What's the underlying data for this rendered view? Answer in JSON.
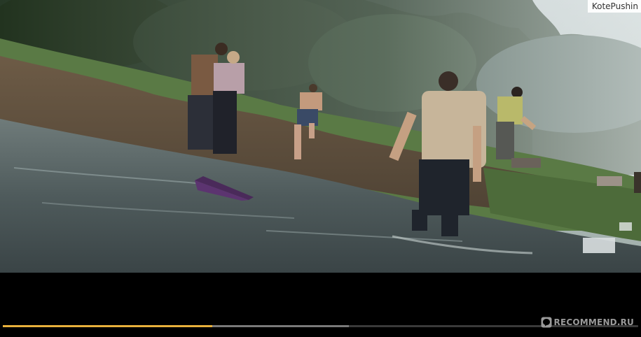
{
  "video": {
    "scene": "people-fleeing-flood-across-river",
    "username_overlay": "KotePushin"
  },
  "player": {
    "progress_played": 0.33,
    "progress_buffered": 0.545,
    "colors": {
      "played": "#e8b13c",
      "buffered": "#7a7a7a",
      "track": "#3a3a3a"
    }
  },
  "watermark": {
    "text": "RECOMMEND.RU",
    "icon": "recommend-logo-icon"
  }
}
